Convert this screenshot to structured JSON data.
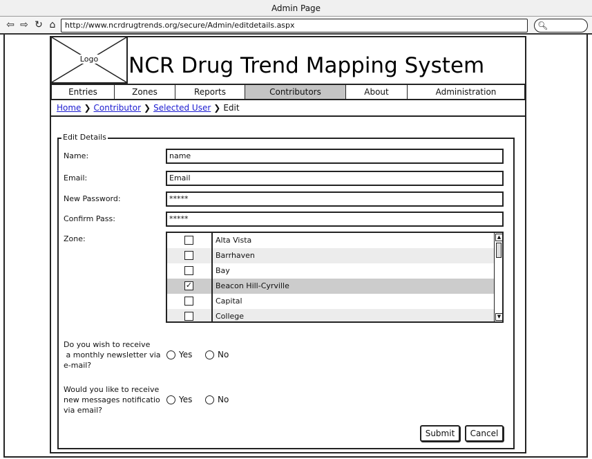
{
  "window": {
    "title": "Admin Page"
  },
  "browser": {
    "url": "http://www.ncrdrugtrends.org/secure/Admin/editdetails.aspx",
    "back_icon": "back-arrow-icon",
    "forward_icon": "forward-arrow-icon",
    "refresh_icon": "refresh-icon",
    "home_icon": "home-icon"
  },
  "header": {
    "logo_label": "Logo",
    "site_title": "NCR Drug Trend Mapping System"
  },
  "nav": {
    "tabs": [
      {
        "label": "Entries"
      },
      {
        "label": "Zones"
      },
      {
        "label": "Reports"
      },
      {
        "label": "Contributors",
        "active": true
      },
      {
        "label": "About"
      },
      {
        "label": "Administration"
      }
    ]
  },
  "breadcrumb": {
    "items": [
      {
        "label": "Home",
        "link": true
      },
      {
        "label": "Contributor",
        "link": true
      },
      {
        "label": "Selected User",
        "link": true
      },
      {
        "label": "Edit",
        "link": false
      }
    ]
  },
  "form": {
    "legend": "Edit Details",
    "name_label": "Name:",
    "name_value": "name",
    "email_label": "Email:",
    "email_value": "Email",
    "password_label": "New Password:",
    "password_value": "*****",
    "confirm_label": "Confirm Pass:",
    "confirm_value": "*****",
    "zone_label": "Zone:",
    "zones": [
      {
        "name": "Alta Vista",
        "checked": false
      },
      {
        "name": "Barrhaven",
        "checked": false
      },
      {
        "name": "Bay",
        "checked": false
      },
      {
        "name": "Beacon Hill-Cyrville",
        "checked": true
      },
      {
        "name": "Capital",
        "checked": false
      },
      {
        "name": "College",
        "checked": false
      }
    ],
    "newsletter_question": "Do you wish to receive\n a monthly newsletter via\ne-mail?",
    "notification_question": "Would you like to receive\nnew messages notificatio\nvia email?",
    "yes_label": "Yes",
    "no_label": "No",
    "submit_label": "Submit",
    "cancel_label": "Cancel"
  }
}
